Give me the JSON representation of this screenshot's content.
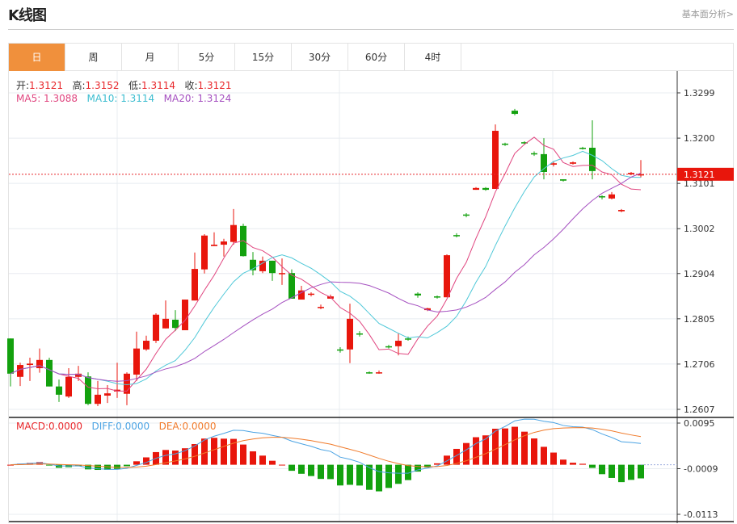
{
  "header": {
    "title": "K线图",
    "fundamental_link": "基本面分析>"
  },
  "tabs": [
    {
      "label": "日",
      "active": true
    },
    {
      "label": "周"
    },
    {
      "label": "月"
    },
    {
      "label": "5分"
    },
    {
      "label": "15分"
    },
    {
      "label": "30分"
    },
    {
      "label": "60分"
    },
    {
      "label": "4时"
    }
  ],
  "ohlc_info": {
    "open_label": "开:",
    "open": "1.3121",
    "high_label": "高:",
    "high": "1.3152",
    "low_label": "低:",
    "low": "1.3114",
    "close_label": "收:",
    "close": "1.3121"
  },
  "ma_info": {
    "ma5": "MA5: 1.3088",
    "ma10": "MA10: 1.3114",
    "ma20": "MA20: 1.3124"
  },
  "macd_info": {
    "macd": "MACD:0.0000",
    "diff": "DIFF:0.0000",
    "dea": "DEA:0.0000"
  },
  "current_price": "1.3121",
  "colors": {
    "up": "#e8160c",
    "down": "#13a10e",
    "ma5": "#e0457f",
    "ma10": "#4fc8d8",
    "ma20": "#a550c0",
    "diff": "#4ba3e3",
    "dea": "#f07a2a",
    "active_tab": "#f0903c"
  },
  "chart_data": {
    "type": "candlestick",
    "price_axis_ticks": [
      "1.3299",
      "1.3200",
      "1.3101",
      "1.3002",
      "1.2904",
      "1.2805",
      "1.2706",
      "1.2607"
    ],
    "price_range": [
      1.2607,
      1.3299
    ],
    "macd_axis_ticks": [
      "0.0095",
      "-0.0009",
      "-0.0113"
    ],
    "macd_range": [
      -0.0113,
      0.0095
    ],
    "ohlc": [
      [
        1.2762,
        1.2762,
        1.2657,
        1.2685
      ],
      [
        1.2678,
        1.2709,
        1.2658,
        1.2704
      ],
      [
        1.2704,
        1.272,
        1.2669,
        1.2707
      ],
      [
        1.2697,
        1.274,
        1.2687,
        1.2715
      ],
      [
        1.2715,
        1.272,
        1.2657,
        1.2657
      ],
      [
        1.2657,
        1.2672,
        1.2623,
        1.2639
      ],
      [
        1.2635,
        1.2697,
        1.2632,
        1.2678
      ],
      [
        1.2678,
        1.2702,
        1.2669,
        1.2685
      ],
      [
        1.2679,
        1.2688,
        1.2616,
        1.2619
      ],
      [
        1.2619,
        1.2669,
        1.2614,
        1.2639
      ],
      [
        1.2637,
        1.266,
        1.2621,
        1.2642
      ],
      [
        1.2646,
        1.2709,
        1.2632,
        1.265
      ],
      [
        1.2641,
        1.2688,
        1.2616,
        1.2685
      ],
      [
        1.2683,
        1.2777,
        1.2669,
        1.274
      ],
      [
        1.2738,
        1.2768,
        1.2735,
        1.2757
      ],
      [
        1.2757,
        1.2817,
        1.2752,
        1.2814
      ],
      [
        1.2784,
        1.2845,
        1.2784,
        1.2805
      ],
      [
        1.2803,
        1.2824,
        1.2778,
        1.2785
      ],
      [
        1.278,
        1.2847,
        1.278,
        1.2847
      ],
      [
        1.2845,
        1.295,
        1.2845,
        1.2914
      ],
      [
        1.2913,
        1.299,
        1.2904,
        1.2987
      ],
      [
        1.2964,
        1.2994,
        1.2964,
        1.2967
      ],
      [
        1.2967,
        1.298,
        1.2941,
        1.2974
      ],
      [
        1.2973,
        1.3045,
        1.2967,
        1.301
      ],
      [
        1.3008,
        1.3013,
        1.2941,
        1.2942
      ],
      [
        1.2934,
        1.2951,
        1.29,
        1.2911
      ],
      [
        1.2909,
        1.2941,
        1.2905,
        1.2932
      ],
      [
        1.2932,
        1.2932,
        1.2888,
        1.2905
      ],
      [
        1.2904,
        1.2937,
        1.2879,
        1.2905
      ],
      [
        1.2905,
        1.2913,
        1.2849,
        1.2849
      ],
      [
        1.2847,
        1.2877,
        1.2847,
        1.2867
      ],
      [
        1.2858,
        1.2863,
        1.2854,
        1.286
      ],
      [
        1.2829,
        1.2836,
        1.2826,
        1.2831
      ],
      [
        1.2849,
        1.2858,
        1.2849,
        1.2854
      ],
      [
        1.2738,
        1.2743,
        1.2731,
        1.2736
      ],
      [
        1.2738,
        1.2838,
        1.2708,
        1.2805
      ],
      [
        1.2773,
        1.2778,
        1.2766,
        1.2771
      ],
      [
        1.2688,
        1.269,
        1.2685,
        1.2687
      ],
      [
        1.2687,
        1.2692,
        1.2685,
        1.2688
      ],
      [
        1.2745,
        1.2748,
        1.274,
        1.2743
      ],
      [
        1.2745,
        1.2773,
        1.2725,
        1.2757
      ],
      [
        1.2762,
        1.2766,
        1.2757,
        1.2761
      ],
      [
        1.286,
        1.2863,
        1.2851,
        1.2856
      ],
      [
        1.2824,
        1.2829,
        1.2822,
        1.2828
      ],
      [
        1.2854,
        1.2856,
        1.2849,
        1.2852
      ],
      [
        1.2852,
        1.2946,
        1.2852,
        1.2944
      ],
      [
        1.2988,
        1.2992,
        1.2983,
        1.2987
      ],
      [
        1.3033,
        1.3036,
        1.3027,
        1.3031
      ],
      [
        1.3087,
        1.3093,
        1.3087,
        1.3091
      ],
      [
        1.3091,
        1.3093,
        1.3085,
        1.3087
      ],
      [
        1.3089,
        1.323,
        1.3089,
        1.3216
      ],
      [
        1.3188,
        1.319,
        1.3183,
        1.3186
      ],
      [
        1.326,
        1.3264,
        1.325,
        1.3253
      ],
      [
        1.3191,
        1.3193,
        1.3186,
        1.319
      ],
      [
        1.3167,
        1.3171,
        1.3161,
        1.3165
      ],
      [
        1.3165,
        1.32,
        1.311,
        1.3126
      ],
      [
        1.3142,
        1.3149,
        1.3138,
        1.3145
      ],
      [
        1.311,
        1.311,
        1.3105,
        1.3107
      ],
      [
        1.3144,
        1.3149,
        1.3142,
        1.3147
      ],
      [
        1.3179,
        1.3181,
        1.3175,
        1.3177
      ],
      [
        1.3179,
        1.3239,
        1.311,
        1.3128
      ],
      [
        1.3073,
        1.3075,
        1.3066,
        1.3071
      ],
      [
        1.3068,
        1.3082,
        1.3066,
        1.3077
      ],
      [
        1.304,
        1.3045,
        1.3038,
        1.3043
      ],
      [
        1.3121,
        1.3126,
        1.3119,
        1.3124
      ],
      [
        1.3121,
        1.3152,
        1.3114,
        1.3121
      ]
    ]
  }
}
